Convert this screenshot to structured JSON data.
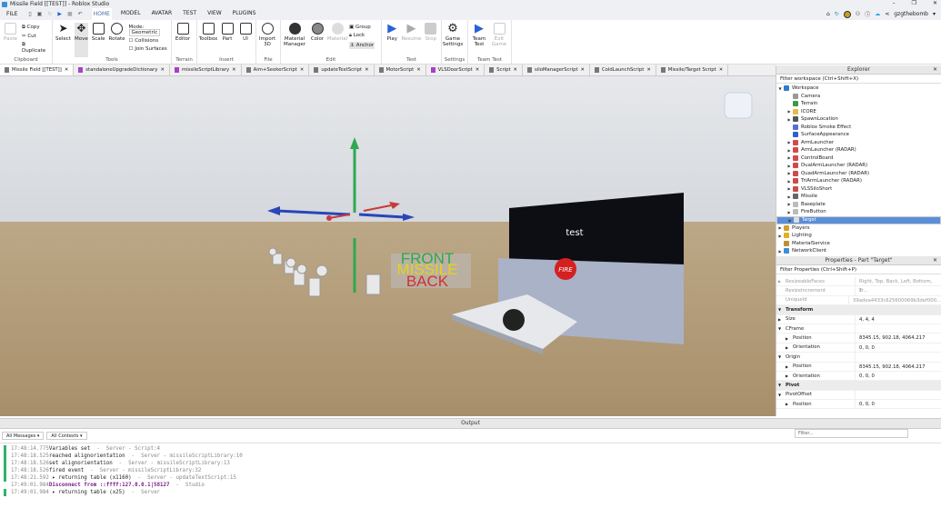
{
  "window": {
    "title": "Missile Field [[TEST]] - Roblox Studio",
    "minimize": "–",
    "restore": "❐",
    "close": "✕"
  },
  "menu": {
    "file": "FILE",
    "tabs": [
      "HOME",
      "MODEL",
      "AVATAR",
      "TEST",
      "VIEW",
      "PLUGINS"
    ],
    "user": "gzgthebomb"
  },
  "ribbon": {
    "clipboard": {
      "paste": "Paste",
      "copy": "Copy",
      "cut": "Cut",
      "duplicate": "Duplicate",
      "label": "Clipboard"
    },
    "tools": {
      "select": "Select",
      "move": "Move",
      "scale": "Scale",
      "rotate": "Rotate",
      "mode_label": "Mode:",
      "mode_value": "Geometric",
      "collisions": "Collisions",
      "join_surfaces": "Join Surfaces",
      "label": "Tools"
    },
    "terrain": {
      "editor": "Editor",
      "label": "Terrain"
    },
    "insert": {
      "toolbox": "Toolbox",
      "part": "Part",
      "ui": "UI",
      "label": "Insert"
    },
    "file": {
      "import3d": "Import 3D",
      "label": "File"
    },
    "edit": {
      "material_manager": "Material Manager",
      "color": "Color",
      "material": "Material",
      "group": "Group",
      "lock": "Lock",
      "anchor": "Anchor",
      "label": "Edit"
    },
    "test": {
      "play": "Play",
      "resume": "Resume",
      "stop": "Stop",
      "label": "Test"
    },
    "settings": {
      "game_settings": "Game Settings",
      "label": "Settings"
    },
    "team_test": {
      "team_test": "Team Test",
      "exit_game": "Exit Game",
      "label": "Team Test"
    }
  },
  "doc_tabs": [
    {
      "label": "Missile Field [[TEST]]",
      "type": "place"
    },
    {
      "label": "standaloneUpgradeDictionary",
      "type": "module"
    },
    {
      "label": "missileScriptLibrary",
      "type": "module"
    },
    {
      "label": "Aim+SeekerScript",
      "type": "script"
    },
    {
      "label": "updateTextScript",
      "type": "script"
    },
    {
      "label": "MotorScript",
      "type": "script"
    },
    {
      "label": "VLSDoorScript",
      "type": "module"
    },
    {
      "label": "Script",
      "type": "script"
    },
    {
      "label": "siloManagerScript",
      "type": "script"
    },
    {
      "label": "ColdLaunchScript",
      "type": "script"
    },
    {
      "label": "Missile/Target Script",
      "type": "script"
    }
  ],
  "viewport": {
    "billboard": "test",
    "fire_button": "FIRE",
    "labels": [
      "FRONT",
      "MISSILE",
      "BACK"
    ]
  },
  "explorer": {
    "title": "Explorer",
    "filter": "Filter workspace (Ctrl+Shift+X)",
    "items": [
      {
        "label": "Workspace",
        "depth": 0,
        "expand": "open",
        "color": "#2a7fc9"
      },
      {
        "label": "Camera",
        "depth": 1,
        "expand": "",
        "color": "#999999"
      },
      {
        "label": "Terrain",
        "depth": 1,
        "expand": "",
        "color": "#3a9a4a"
      },
      {
        "label": "ICORE",
        "depth": 1,
        "expand": "closed",
        "color": "#e8b84a"
      },
      {
        "label": "SpawnLocation",
        "depth": 1,
        "expand": "closed",
        "color": "#555555"
      },
      {
        "label": "Roblox Smoke Effect",
        "depth": 1,
        "expand": "",
        "color": "#5a6fd0"
      },
      {
        "label": "SurfaceAppearance",
        "depth": 1,
        "expand": "",
        "color": "#3060d0"
      },
      {
        "label": "ArmLauncher",
        "depth": 1,
        "expand": "closed",
        "color": "#d04a4a"
      },
      {
        "label": "ArmLauncher (RADAR)",
        "depth": 1,
        "expand": "closed",
        "color": "#d04a4a"
      },
      {
        "label": "ControlBoard",
        "depth": 1,
        "expand": "closed",
        "color": "#d04a4a"
      },
      {
        "label": "DualArmLauncher (RADAR)",
        "depth": 1,
        "expand": "closed",
        "color": "#d04a4a"
      },
      {
        "label": "QuadArmLauncher (RADAR)",
        "depth": 1,
        "expand": "closed",
        "color": "#d04a4a"
      },
      {
        "label": "TriArmLauncher (RADAR)",
        "depth": 1,
        "expand": "closed",
        "color": "#d04a4a"
      },
      {
        "label": "VLSSiloShort",
        "depth": 1,
        "expand": "closed",
        "color": "#d04a4a"
      },
      {
        "label": "Missile",
        "depth": 1,
        "expand": "closed",
        "color": "#666666"
      },
      {
        "label": "Baseplate",
        "depth": 1,
        "expand": "closed",
        "color": "#bbbbbb"
      },
      {
        "label": "FireButton",
        "depth": 1,
        "expand": "closed",
        "color": "#bbbbbb"
      },
      {
        "label": "Target",
        "depth": 1,
        "expand": "closed",
        "color": "#dddddd",
        "selected": true
      },
      {
        "label": "Players",
        "depth": 0,
        "expand": "closed",
        "color": "#d0a030"
      },
      {
        "label": "Lighting",
        "depth": 0,
        "expand": "closed",
        "color": "#e0b020"
      },
      {
        "label": "MaterialService",
        "depth": 0,
        "expand": "",
        "color": "#c09030"
      },
      {
        "label": "NetworkClient",
        "depth": 0,
        "expand": "closed",
        "color": "#3a8fd6"
      }
    ]
  },
  "properties": {
    "title": "Properties - Part \"Target\"",
    "filter": "Filter Properties (Ctrl+Shift+P)",
    "rows": [
      {
        "name": "ResizeableFaces",
        "value": "Right, Top, Back, Left, Bottom, Fr...",
        "kind": "dim",
        "expand": "closed",
        "depth": 0
      },
      {
        "name": "ResizeIncrement",
        "value": "1",
        "kind": "dim",
        "expand": "",
        "depth": 0
      },
      {
        "name": "UniqueId",
        "value": "39adea4433c625600069b3def000...",
        "kind": "dim",
        "expand": "",
        "depth": 0
      },
      {
        "name": "Transform",
        "value": "",
        "kind": "cat",
        "expand": "open",
        "depth": 0
      },
      {
        "name": "Size",
        "value": "4, 4, 4",
        "kind": "",
        "expand": "closed",
        "depth": 0
      },
      {
        "name": "CFrame",
        "value": "",
        "kind": "",
        "expand": "open",
        "depth": 0
      },
      {
        "name": "Position",
        "value": "8345.15, 902.18, 4064.217",
        "kind": "",
        "expand": "closed",
        "depth": 1
      },
      {
        "name": "Orientation",
        "value": "0, 0, 0",
        "kind": "",
        "expand": "closed",
        "depth": 1
      },
      {
        "name": "Origin",
        "value": "",
        "kind": "",
        "expand": "open",
        "depth": 0
      },
      {
        "name": "Position",
        "value": "8345.15, 902.18, 4064.217",
        "kind": "",
        "expand": "closed",
        "depth": 1
      },
      {
        "name": "Orientation",
        "value": "0, 0, 0",
        "kind": "",
        "expand": "closed",
        "depth": 1
      },
      {
        "name": "Pivot",
        "value": "",
        "kind": "cat",
        "expand": "open",
        "depth": 0
      },
      {
        "name": "PivotOffset",
        "value": "",
        "kind": "",
        "expand": "open",
        "depth": 0
      },
      {
        "name": "Position",
        "value": "0, 0, 0",
        "kind": "",
        "expand": "closed",
        "depth": 1
      }
    ]
  },
  "output": {
    "title": "Output",
    "messages_filter": "All Messages",
    "contexts_filter": "All Contexts",
    "search_placeholder": "Filter...",
    "logs": [
      {
        "time": "17:48:14.775",
        "msg": "Variables set",
        "src": "  -  Server - Script:4",
        "color": "#222222",
        "bar": "#2fb36b"
      },
      {
        "time": "17:48:18.525",
        "msg": "reached alignorientation",
        "src": "  -  Server - missileScriptLibrary:10",
        "color": "#222222",
        "bar": "#2fb36b"
      },
      {
        "time": "17:48:18.526",
        "msg": "set alignorientation",
        "src": "  -  Server - missileScriptLibrary:13",
        "color": "#222222",
        "bar": "#2fb36b"
      },
      {
        "time": "17:48:18.526",
        "msg": "fired event",
        "src": "  -  Server - missileScriptLibrary:32",
        "color": "#222222",
        "bar": "#2fb36b"
      },
      {
        "time": "17:48:21.592",
        "msg": " ▸ returning table (x1160)",
        "src": "  -  Server - updateTextScript:15",
        "color": "#222222",
        "bar": "#2fb36b"
      },
      {
        "time": "17:49:01.984",
        "msg": "Disconnect from ::ffff:127.0.0.1|58127",
        "src": "  -  Studio",
        "color": "#7a1f8a",
        "bar": ""
      },
      {
        "time": "17:49:01.984",
        "msg": " ▸ returning table (x25)",
        "src": "  -  Server",
        "color": "#222222",
        "bar": "#2fb36b"
      }
    ]
  }
}
